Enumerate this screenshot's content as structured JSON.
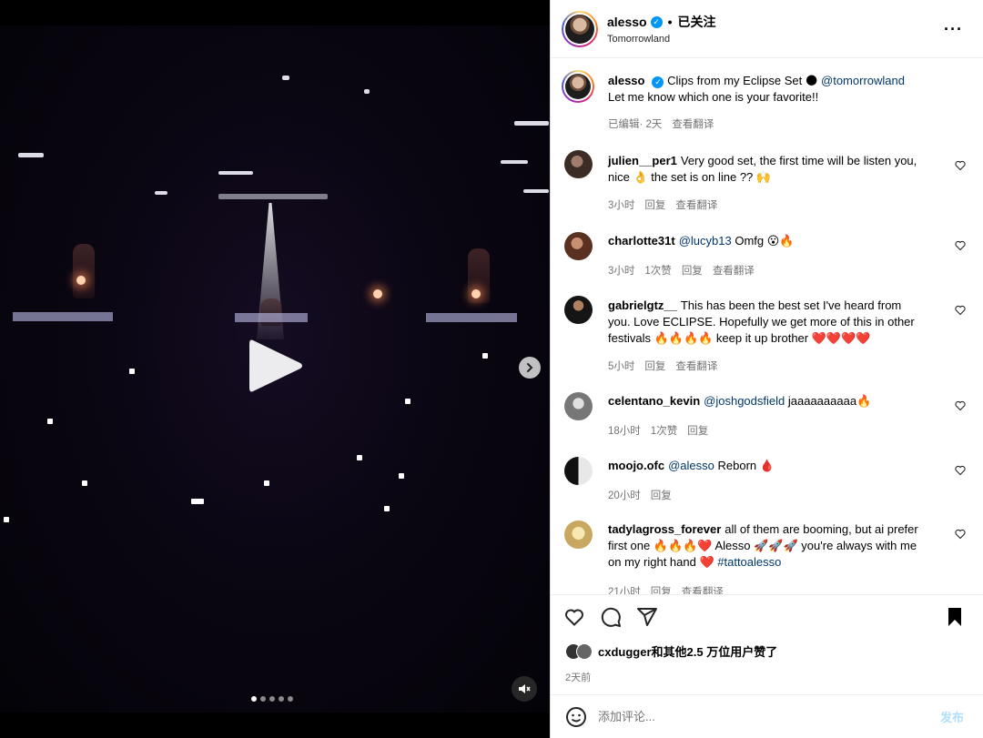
{
  "media": {
    "carousel": {
      "count": 5,
      "active_index": 0
    }
  },
  "header": {
    "username": "alesso",
    "separator": "•",
    "follow_state": "已关注",
    "location": "Tomorrowland",
    "more_icon": "more-horizontal-icon"
  },
  "caption": {
    "username": "alesso",
    "text": "Clips from my Eclipse Set",
    "mention": "@tomorrowland",
    "line2": "Let me know which one is your favorite!!",
    "edited": "已编辑",
    "time": "· 2天",
    "translate": "查看翻译"
  },
  "comments": [
    {
      "username": "julien__per1",
      "text": "Very good set, the first time will be listen you, nice 👌 the set is on line ?? 🙌",
      "time": "3小时",
      "likes": "",
      "reply": "回复",
      "translate": "查看翻译"
    },
    {
      "username": "charlotte31t",
      "mention": "@lucyb13",
      "text": "Omfg 😮🔥",
      "time": "3小时",
      "likes": "1次赞",
      "reply": "回复",
      "translate": "查看翻译"
    },
    {
      "username": "gabrielgtz__",
      "text": "This has been the best set I've heard from you. Love ECLIPSE. Hopefully we get more of this in other festivals 🔥🔥🔥🔥 keep it up brother ❤️❤️❤️❤️",
      "time": "5小时",
      "likes": "",
      "reply": "回复",
      "translate": "查看翻译"
    },
    {
      "username": "celentano_kevin",
      "mention": "@joshgodsfield",
      "text": "jaaaaaaaaaa🔥",
      "time": "18小时",
      "likes": "1次赞",
      "reply": "回复",
      "translate": ""
    },
    {
      "username": "moojo.ofc",
      "mention": "@alesso",
      "text": "Reborn 🩸",
      "time": "20小时",
      "likes": "",
      "reply": "回复",
      "translate": ""
    },
    {
      "username": "tadylagross_forever",
      "text": "all of them are booming, but ai prefer first one 🔥🔥🔥❤️ Alesso 🚀🚀🚀 you're always with me on my right hand ❤️",
      "hashtag": "#tattoalesso",
      "time": "21小时",
      "likes": "",
      "reply": "回复",
      "translate": "查看翻译"
    }
  ],
  "actions": {
    "like_icon": "heart-icon",
    "comment_icon": "comment-icon",
    "share_icon": "send-icon",
    "save_icon": "bookmark-icon",
    "likes_text": "cxdugger和其他2.5 万位用户赞了",
    "date": "2天前"
  },
  "composer": {
    "placeholder": "添加评论...",
    "post_label": "发布"
  },
  "colors": {
    "link": "#00376b",
    "verified": "#0095f6",
    "muted": "#737373",
    "post_disabled": "#b2dffc"
  }
}
